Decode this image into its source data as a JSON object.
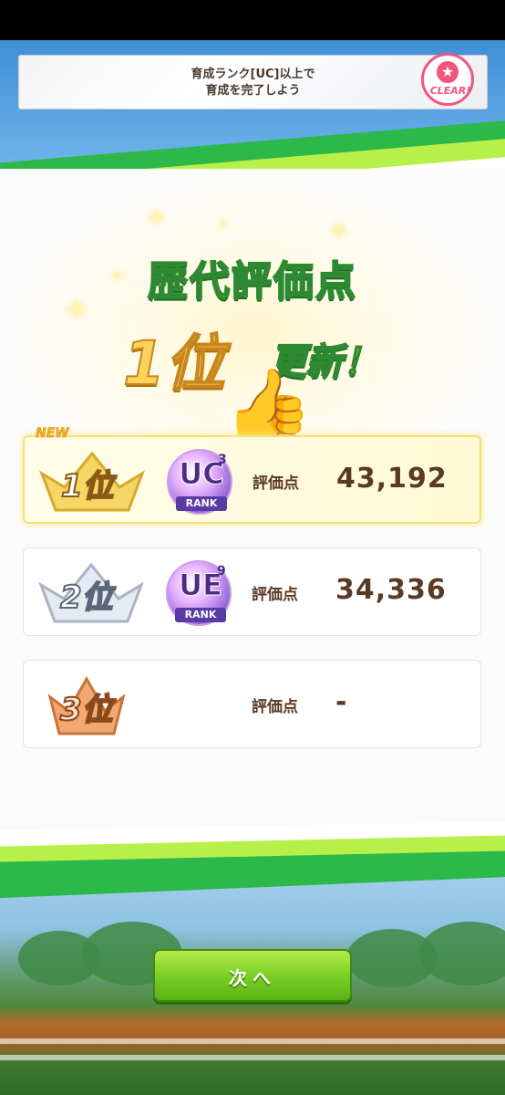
{
  "mission": {
    "text_line1": "育成ランク[UC]以上で",
    "text_line2": "育成を完了しよう",
    "badge_label": "CLEAR!"
  },
  "headline": {
    "title": "歴代評価点",
    "rank": "1位",
    "updated": "更新！"
  },
  "ranking": [
    {
      "new_tag": "NEW",
      "place": "1位",
      "rank_letters": "UC",
      "rank_sup": "3",
      "rank_word": "RANK",
      "score_label": "評価点",
      "score": "43,192"
    },
    {
      "place": "2位",
      "rank_letters": "UE",
      "rank_sup": "9",
      "rank_word": "RANK",
      "score_label": "評価点",
      "score": "34,336"
    },
    {
      "place": "3位",
      "score_label": "評価点",
      "score": "-"
    }
  ],
  "next_button": {
    "label": "次へ"
  },
  "colors": {
    "accent_green": "#77cc22",
    "stripe_green": "#2db84a",
    "stripe_lime": "#b8f04a",
    "score_brown": "#5a3a24",
    "badge_pink": "#f0557c"
  },
  "icons": {
    "thumbs": "thumbs-up-icon",
    "crown": "crown-icon",
    "sparkle": "sparkle-icon",
    "clear": "clear-badge-icon"
  }
}
